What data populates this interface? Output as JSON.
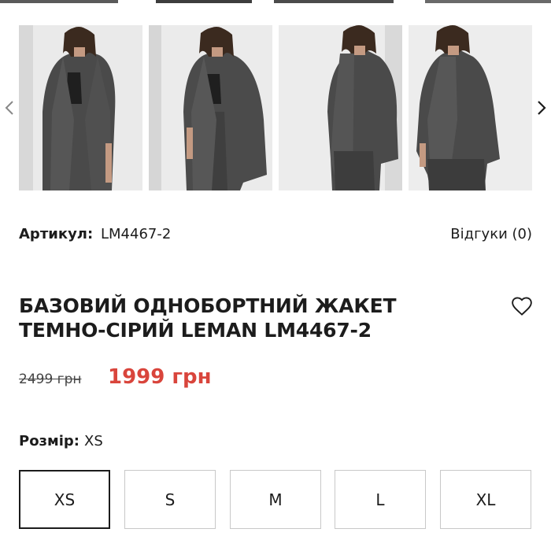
{
  "product": {
    "sku_label": "Артикул:",
    "sku_value": "LM4467-2",
    "reviews": "Відгуки (0)",
    "title_lines": [
      "БАЗОВИЙ ОДНОБОРТНИЙ ЖАКЕТ",
      "ТЕМНО-СІРИЙ LEMAN LM4467-2"
    ],
    "old_price": "2499 грн",
    "new_price": "1999 грн",
    "price_color": "#d9453c"
  },
  "gallery": {
    "icons": {
      "prev": "chevron-left-icon",
      "next": "chevron-right-icon"
    },
    "photo_count": 4
  },
  "favorite": {
    "icon": "heart-outline-icon"
  },
  "size": {
    "label": "Розмір:",
    "selected": "XS",
    "options": [
      "XS",
      "S",
      "M",
      "L",
      "XL"
    ]
  }
}
